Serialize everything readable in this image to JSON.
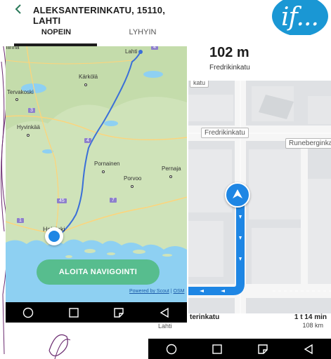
{
  "brand": {
    "logo_text": "if...",
    "logo_color": "#1a97d4"
  },
  "route_screen": {
    "title": "ALEKSANTERINKATU, 15110, LAHTI",
    "tabs": [
      {
        "label": "NOPEIN",
        "selected": true
      },
      {
        "label": "LYHYIN",
        "selected": false
      }
    ],
    "map": {
      "places": [
        "Lahti",
        "Kärkölä",
        "Tervakoski",
        "Hyvinkää",
        "Pornainen",
        "Porvoo",
        "Pernaja",
        "Helsinki"
      ],
      "place_partial": "nlinna",
      "road_numbers": [
        "4",
        "3",
        "4",
        "45",
        "7",
        "1"
      ]
    },
    "start_button": "ALOITA NAVIGOINTI",
    "credit": {
      "text": "Powered by Scout",
      "separator": " | ",
      "link": "OSM"
    },
    "route_color": "#3a6fd8",
    "button_color": "#57bd8e"
  },
  "nav_screen": {
    "next_turn_distance": "102 m",
    "next_turn_street": "Fredrikinkatu",
    "map_labels": [
      "Fredrikinkatu",
      "Runeberginkatu",
      "katu"
    ],
    "bottom": {
      "destination_partial": "terinkatu",
      "destination_city": "Lahti",
      "eta": "1 t 14 min",
      "remaining_distance": "108 km"
    },
    "route_color": "#1e86e4"
  },
  "nav_bar": [
    "back-circle-icon",
    "home-square-icon",
    "recent-apps-icon",
    "back-triangle-icon"
  ]
}
